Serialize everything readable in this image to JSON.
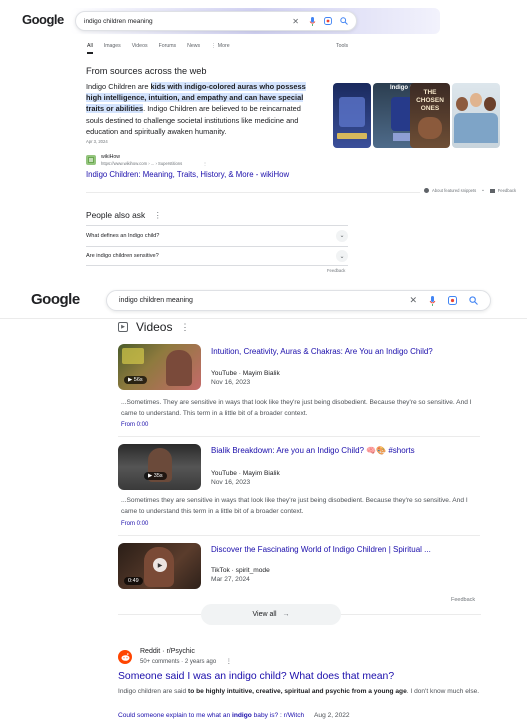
{
  "top": {
    "logo": "Google",
    "query": "indigo children meaning",
    "tabs": [
      "All",
      "Images",
      "Videos",
      "Forums",
      "News",
      "⋮ More"
    ],
    "tools": "Tools"
  },
  "featured": {
    "heading": "From sources across the web",
    "s1": "Indigo Children are ",
    "s1_hl": "kids with indigo-colored auras who possess high intelligence, intuition, and empathy and can have special traits or abilities",
    "s2": ". Indigo Children are believed to be reincarnated souls destined to challenge societal institutions like medicine and education and spiritually awaken humanity.",
    "date": "Apr 3, 2024",
    "source_name": "wikiHow",
    "source_url": "https://www.wikihow.com › ... › Superstitions",
    "source_more": "⋮",
    "link": "Indigo Children: Meaning, Traits, History, & More - wikiHow",
    "about": "About featured snippets",
    "sep": "•",
    "feedback": "Feedback",
    "images": {
      "img2_title": "Indigo Child",
      "img3_title": "THE CHOSEN ONES"
    }
  },
  "paa": {
    "heading": "People also ask",
    "items": [
      "What defines an Indigo child?",
      "Are indigo children sensitive?"
    ],
    "feedback": "Feedback"
  },
  "second": {
    "logo": "Google",
    "query": "indigo children meaning"
  },
  "videos": {
    "heading": "Videos",
    "more": "⋮",
    "items": [
      {
        "title": "Intuition, Creativity, Auras & Chakras: Are You an Indigo Child?",
        "source": "YouTube · Mayim Bialik",
        "date": "Nov 16, 2023",
        "duration": "▶ 56s",
        "desc": "...Sometimes. They are sensitive in ways that look like they're just being disobedient. Because they're so sensitive. And I came to understand. This term in a little bit of a broader context.",
        "from": "From 0:00"
      },
      {
        "title": "Bialik Breakdown: Are you an Indigo Child? 🧠🎨 #shorts",
        "source": "YouTube · Mayim Bialik",
        "date": "Nov 16, 2023",
        "duration": "▶ 35s",
        "desc": "...Sometimes they are sensitive in ways that look like they're just being disobedient. Because they're so sensitive. And I came to understand this term in a little bit of a broader context.",
        "from": "From 0:00"
      },
      {
        "title": "Discover the Fascinating World of Indigo Children | Spiritual ...",
        "source": "TikTok · spirit_mode",
        "date": "Mar 27, 2024",
        "duration": "0:49"
      }
    ],
    "feedback": "Feedback",
    "view_all": "View all",
    "view_all_arrow": "→"
  },
  "reddit": {
    "source": "Reddit · r/Psychic",
    "meta": "50+ comments · 2 years ago",
    "more": "⋮",
    "title": "Someone said I was an indigo child? What does that mean?",
    "snip1": "Indigo children are said ",
    "snip_bold": "to be highly intuitive, creative, spiritual and psychic from a young age",
    "snip2": ". I don't know much else.",
    "sub_link_pre": "Could someone explain to me what an ",
    "sub_link_bold": "indigo",
    "sub_link_post": " baby is? : r/Witch",
    "sub_date": "Aug 2, 2022"
  }
}
